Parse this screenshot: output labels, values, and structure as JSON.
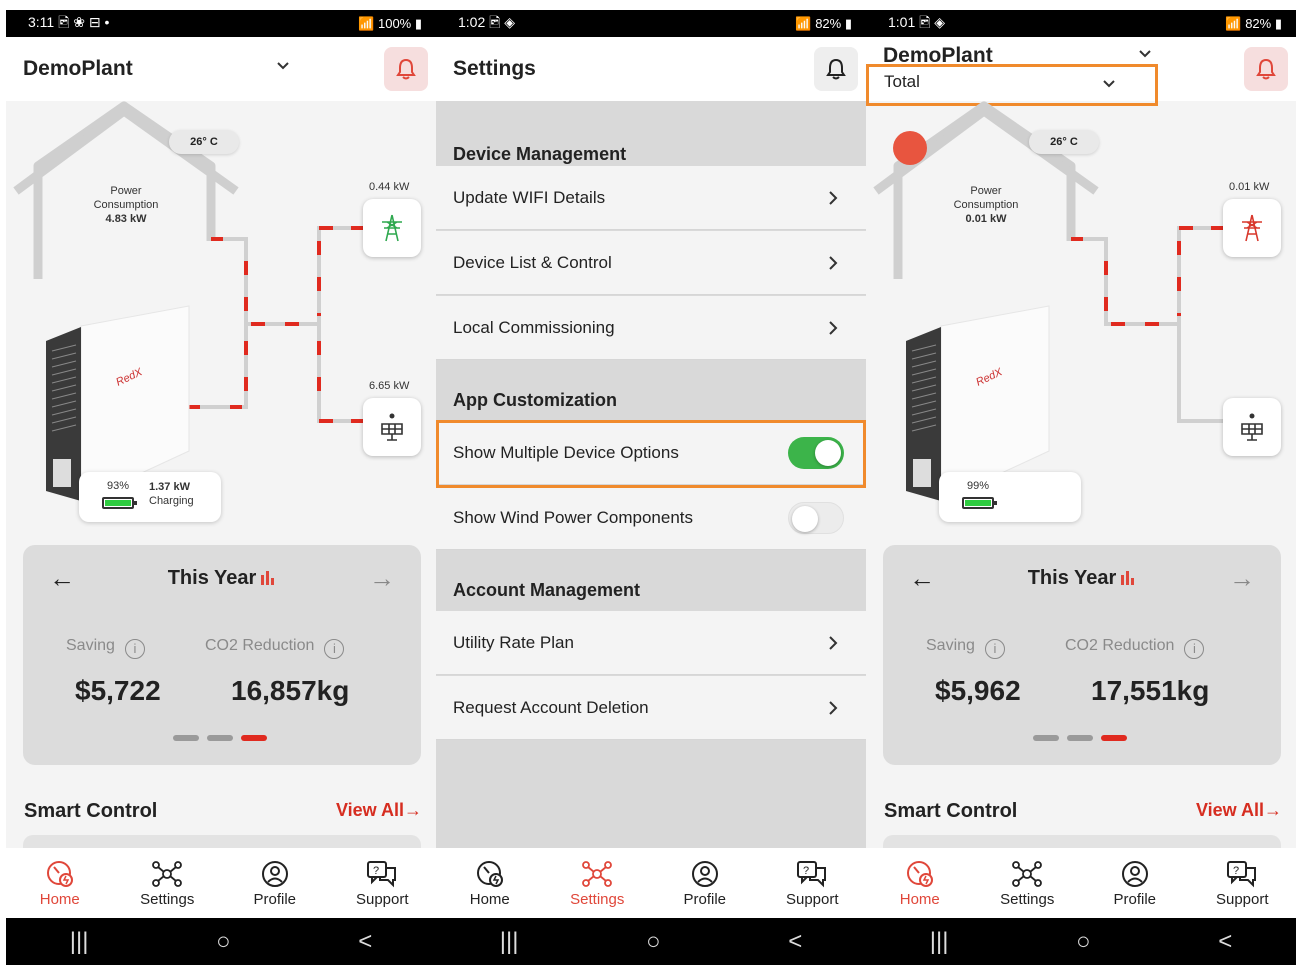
{
  "colors": {
    "accent": "#e0473a",
    "highlight": "#f08a2c",
    "toggle_on": "#3cb44a"
  },
  "phone1": {
    "status": {
      "time": "3:11",
      "icons": "🖻 ❀ ⊟ •",
      "right": "100%"
    },
    "title": "DemoPlant",
    "temperature": "26° C",
    "power": {
      "label1": "Power",
      "label2": "Consumption",
      "value": "4.83 kW"
    },
    "grid_kw": "0.44 kW",
    "solar_kw": "6.65 kW",
    "battery": {
      "percent": "93%",
      "kw": "1.37 kW",
      "state": "Charging"
    },
    "year_card": {
      "title": "This Year",
      "saving_label": "Saving",
      "co2_label": "CO2 Reduction",
      "saving_value": "$5,722",
      "co2_value": "16,857kg"
    },
    "smart_control": "Smart Control",
    "view_all": "View All→"
  },
  "phone2": {
    "status": {
      "time": "1:02",
      "icons": "🖻 ◈",
      "right": "82%"
    },
    "title": "Settings",
    "sections": {
      "device": "Device Management",
      "app": "App Customization",
      "account": "Account Management"
    },
    "rows": {
      "wifi": "Update WIFI Details",
      "device_list": "Device List & Control",
      "local": "Local Commissioning",
      "multi": "Show Multiple Device Options",
      "wind": "Show Wind Power Components",
      "rate": "Utility Rate Plan",
      "delete": "Request Account Deletion"
    }
  },
  "phone3": {
    "status": {
      "time": "1:01",
      "icons": "🖻 ◈",
      "right": "82%"
    },
    "title": "DemoPlant",
    "subselect": "Total",
    "temperature": "26° C",
    "power": {
      "label1": "Power",
      "label2": "Consumption",
      "value": "0.01 kW"
    },
    "grid_kw": "0.01 kW",
    "battery": {
      "percent": "99%"
    },
    "year_card": {
      "title": "This Year",
      "saving_label": "Saving",
      "co2_label": "CO2 Reduction",
      "saving_value": "$5,962",
      "co2_value": "17,551kg"
    },
    "smart_control": "Smart Control",
    "view_all": "View All→"
  },
  "tabs": {
    "home": "Home",
    "settings": "Settings",
    "profile": "Profile",
    "support": "Support"
  },
  "nav": {
    "recent": "|||",
    "home": "○",
    "back": "<"
  }
}
